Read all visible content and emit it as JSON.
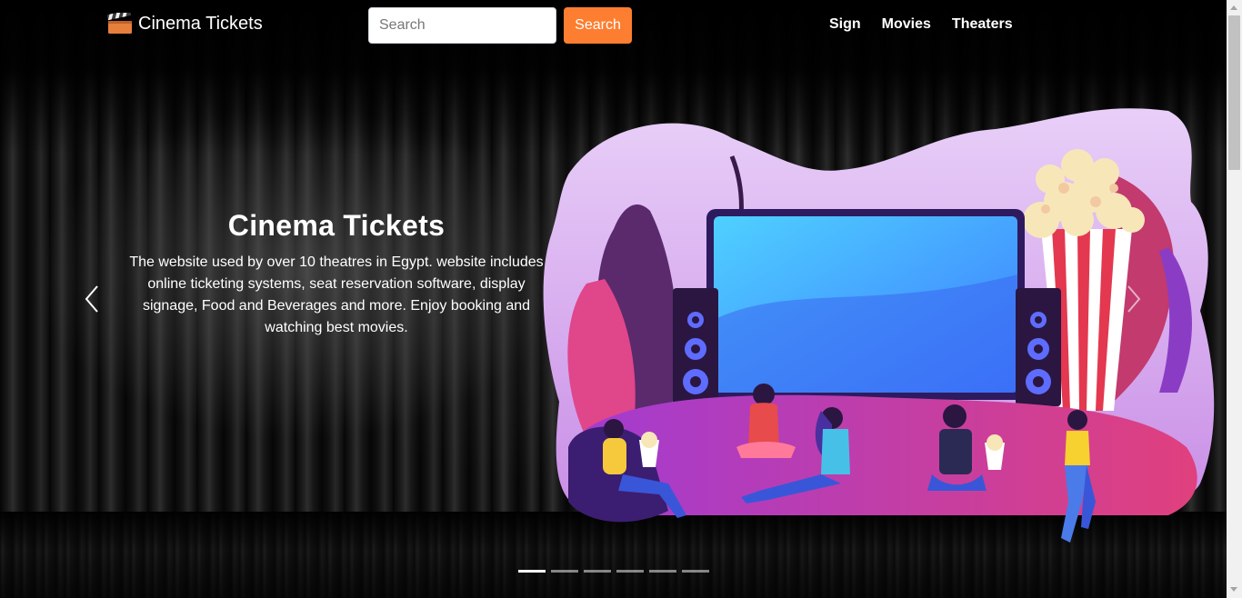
{
  "navbar": {
    "brand": "Cinema Tickets",
    "brand_icon": "clapperboard-icon",
    "search_placeholder": "Search",
    "search_button": "Search",
    "links": [
      "Sign",
      "Movies",
      "Theaters"
    ]
  },
  "carousel": {
    "title": "Cinema Tickets",
    "text": "The website used by over 10 theatres in Egypt. website includes online ticketing systems, seat reservation software, display signage, Food and Beverages and more. Enjoy booking and watching best movies.",
    "prev_icon": "chevron-left-icon",
    "next_icon": "chevron-right-icon",
    "slide_count": 6,
    "active_slide": 1,
    "illustration": "home-theater-illustration"
  },
  "colors": {
    "accent": "#fd7e30",
    "background": "#000000",
    "text": "#ffffff"
  }
}
